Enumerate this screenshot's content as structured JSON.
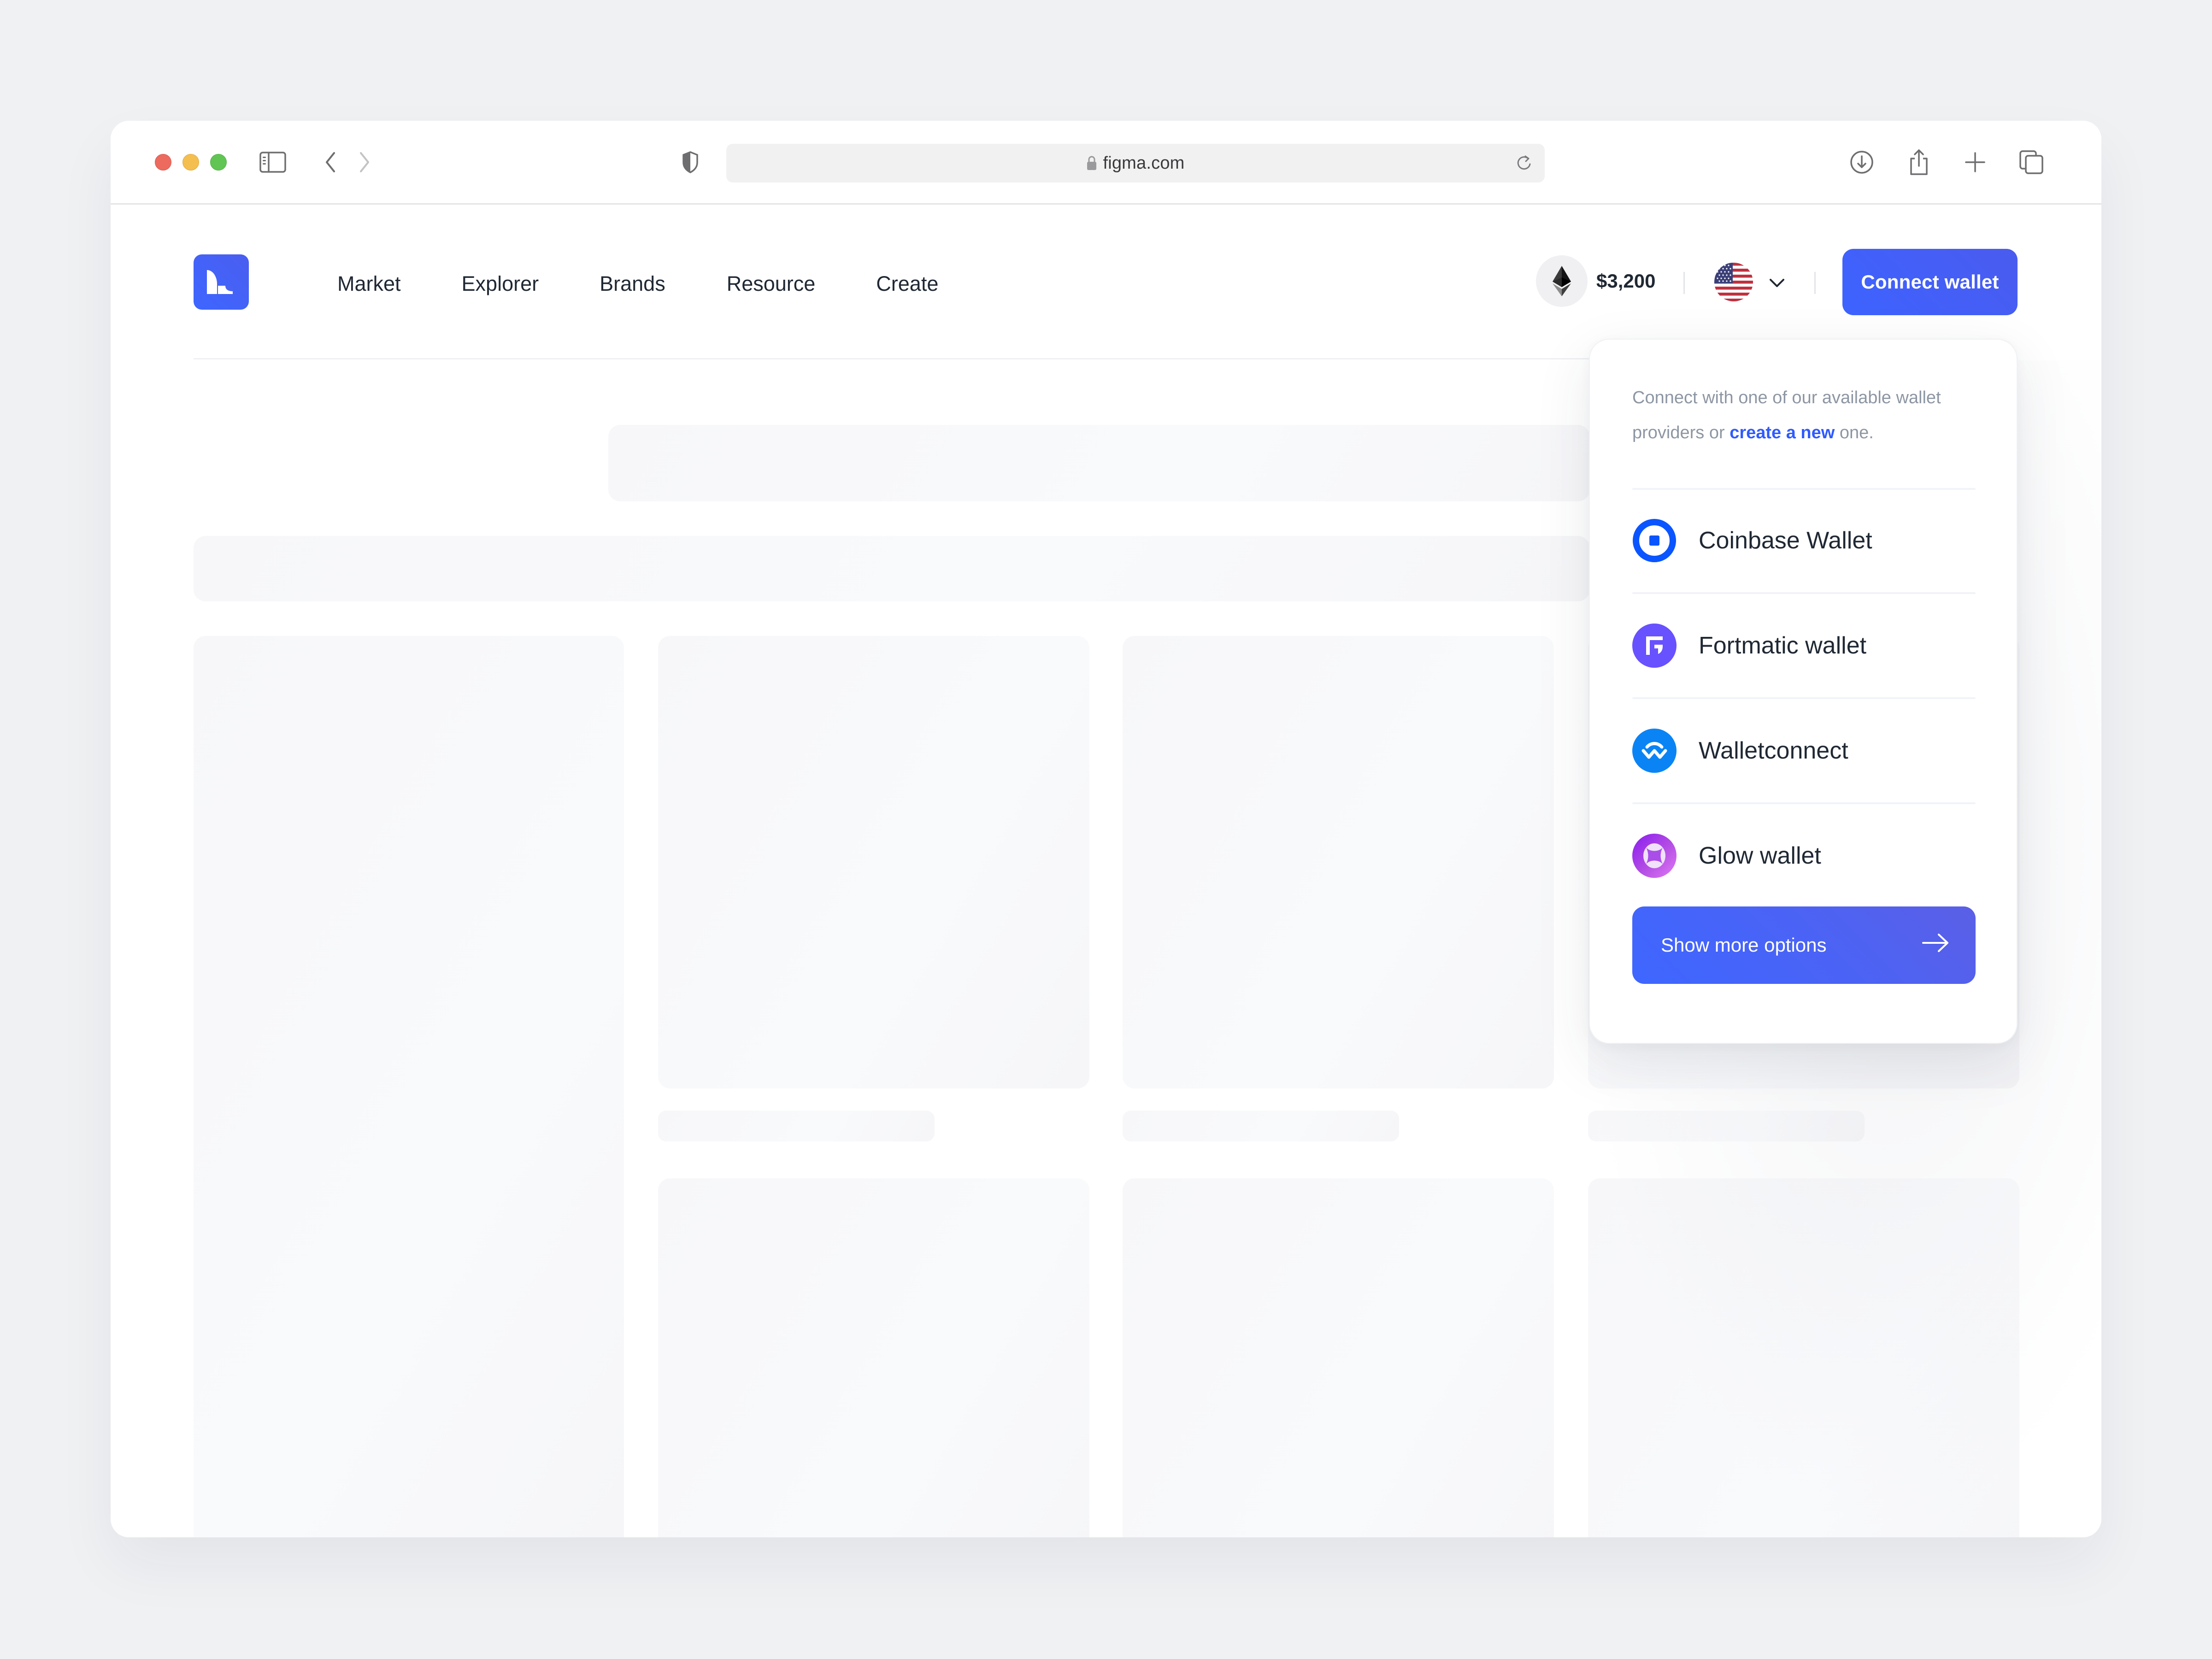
{
  "browser": {
    "url": "figma.com",
    "icons": {
      "sidebar": "sidebar-toggle-icon",
      "back": "chevron-left-icon",
      "forward": "chevron-right-icon",
      "privacy": "shield-icon",
      "lock": "lock-icon",
      "reload": "reload-icon",
      "download": "download-icon",
      "share": "share-icon",
      "new_tab": "plus-icon",
      "tabs": "tabs-overview-icon"
    }
  },
  "header": {
    "logo": "brand-logo",
    "nav": [
      {
        "label": "Market"
      },
      {
        "label": "Explorer"
      },
      {
        "label": "Brands"
      },
      {
        "label": "Resource"
      },
      {
        "label": "Create"
      }
    ],
    "eth_price": "$3,200",
    "language": "US",
    "connect_wallet_label": "Connect wallet",
    "colors": {
      "accent": "#3d63ff",
      "text": "#1f2833"
    }
  },
  "wallet_dropdown": {
    "intro_prefix": "Connect with one of our available wallet providers or ",
    "intro_link": "create a new",
    "intro_suffix": " one.",
    "wallets": [
      {
        "name": "Coinbase Wallet",
        "icon": "coinbase-icon",
        "color": "#0052ff"
      },
      {
        "name": "Fortmatic wallet",
        "icon": "fortmatic-icon",
        "color": "#6851ff"
      },
      {
        "name": "Walletconnect",
        "icon": "walletconnect-icon",
        "color": "#0a84f5"
      },
      {
        "name": "Glow wallet",
        "icon": "glow-icon",
        "color": "#a94ee8"
      }
    ],
    "more_options_label": "Show more options",
    "link_color": "#2f5bff"
  }
}
